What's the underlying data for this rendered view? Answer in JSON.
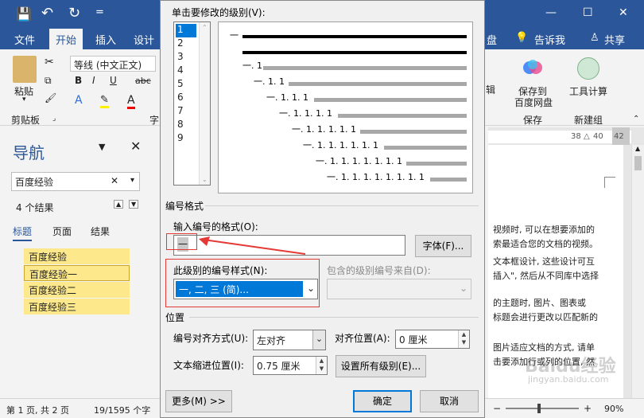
{
  "window": {
    "title_partial": "",
    "minimize": "—",
    "restore": "☐",
    "close": "✕"
  },
  "quick_access": {
    "save_icon": "save-icon",
    "undo": "↶",
    "redo": "↻",
    "more": "="
  },
  "ribbon_tabs": [
    "文件",
    "开始",
    "插入",
    "设计"
  ],
  "ribbon_right": {
    "netdisk": "盘",
    "tell_me": "告诉我",
    "share": "共享"
  },
  "ribbon": {
    "paste": "粘贴",
    "clipboard": "剪贴板",
    "font_name": "等线 (中文正文)",
    "bold": "B",
    "italic": "I",
    "underline": "U",
    "strike": "abc",
    "sub": "x₂",
    "font_group_partial": "字",
    "edit_partial": "辑",
    "save_to_baidu": [
      "保存到",
      "百度网盘"
    ],
    "save_group": "保存",
    "tools_calc": "工具计算",
    "new_group": "新建组"
  },
  "nav": {
    "title": "导航",
    "search_value": "百度经验",
    "result_count": "4 个结果",
    "tabs": [
      "标题",
      "页面",
      "结果"
    ],
    "results": [
      "百度经验",
      "百度经验一",
      "百度经验二",
      "百度经验三"
    ]
  },
  "ruler": {
    "n38": "38",
    "n40": "40",
    "n42": "42"
  },
  "doc_lines": [
    "视频时, 可以在想要添加的",
    "索最适合您的文档的视频。",
    "文本框设计, 这些设计可互",
    "插入\", 然后从不同库中选择",
    "的主题时, 图片、图表或",
    "标题会进行更改以匹配新的",
    "图片适应文档的方式, 请单",
    "击要添加行或列的位置, 然"
  ],
  "status": {
    "page": "第 1 页, 共 2 页",
    "words": "19/1595 个字",
    "zoom": "90%"
  },
  "dialog": {
    "level_label": "单击要修改的级别(V):",
    "levels": [
      "1",
      "2",
      "3",
      "4",
      "5",
      "6",
      "7",
      "8",
      "9"
    ],
    "preview_labels": [
      "一",
      "一. 1",
      "一. 1. 1",
      "一. 1. 1. 1",
      "一. 1. 1. 1. 1",
      "一. 1. 1. 1. 1. 1",
      "一. 1. 1. 1. 1. 1. 1",
      "一. 1. 1. 1. 1. 1. 1. 1",
      "一. 1. 1. 1. 1. 1. 1. 1. 1"
    ],
    "numbering_format_section": "编号格式",
    "enter_format_label": "输入编号的格式(O):",
    "format_value": "一",
    "font_button": "字体(F)...",
    "style_label": "此级别的编号样式(N):",
    "style_value": "一, 二, 三 (简)...",
    "include_label": "包含的级别编号来自(D):",
    "position_section": "位置",
    "alignment_label": "编号对齐方式(U):",
    "alignment_value": "左对齐",
    "align_at_label": "对齐位置(A):",
    "align_at_value": "0 厘米",
    "indent_label": "文本缩进位置(I):",
    "indent_value": "0.75 厘米",
    "set_all_button": "设置所有级别(E)...",
    "more_button": "更多(M) >>",
    "ok_button": "确定",
    "cancel_button": "取消"
  },
  "watermark": "Baidu经验",
  "watermark_sub": "jingyan.baidu.com",
  "colors": {
    "word_blue": "#2b579a",
    "highlight": "#fde98c",
    "select_blue": "#0078d7",
    "annotation_red": "#e53935"
  }
}
